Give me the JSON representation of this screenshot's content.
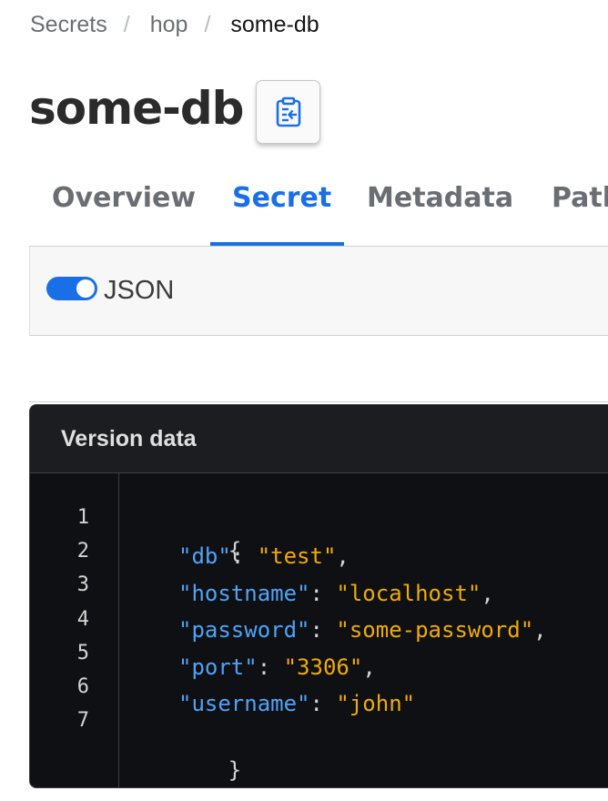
{
  "breadcrumb": {
    "items": [
      "Secrets",
      "hop"
    ],
    "separator": "/",
    "current": "some-db"
  },
  "page": {
    "title": "some-db",
    "copy_icon": "clipboard-icon"
  },
  "tabs": [
    {
      "label": "Overview",
      "active": false
    },
    {
      "label": "Secret",
      "active": true
    },
    {
      "label": "Metadata",
      "active": false
    },
    {
      "label": "Paths",
      "active": false
    }
  ],
  "toolbar": {
    "json_toggle_label": "JSON",
    "json_toggle_on": true
  },
  "code_panel": {
    "title": "Version data",
    "line_numbers": [
      "1",
      "2",
      "3",
      "4",
      "5",
      "6",
      "7"
    ],
    "open_brace": "{",
    "close_brace": "}",
    "entries": [
      {
        "key": "\"db\"",
        "value": "\"test\"",
        "trail": ","
      },
      {
        "key": "\"hostname\"",
        "value": "\"localhost\"",
        "trail": ","
      },
      {
        "key": "\"password\"",
        "value": "\"some-password\"",
        "trail": ","
      },
      {
        "key": "\"port\"",
        "value": "\"3306\"",
        "trail": ","
      },
      {
        "key": "\"username\"",
        "value": "\"john\"",
        "trail": ""
      }
    ],
    "colon": ": "
  },
  "colors": {
    "accent": "#1a6fe8",
    "code_key": "#4fa3f7",
    "code_value": "#f0ab00",
    "code_bg": "#0f1013"
  }
}
